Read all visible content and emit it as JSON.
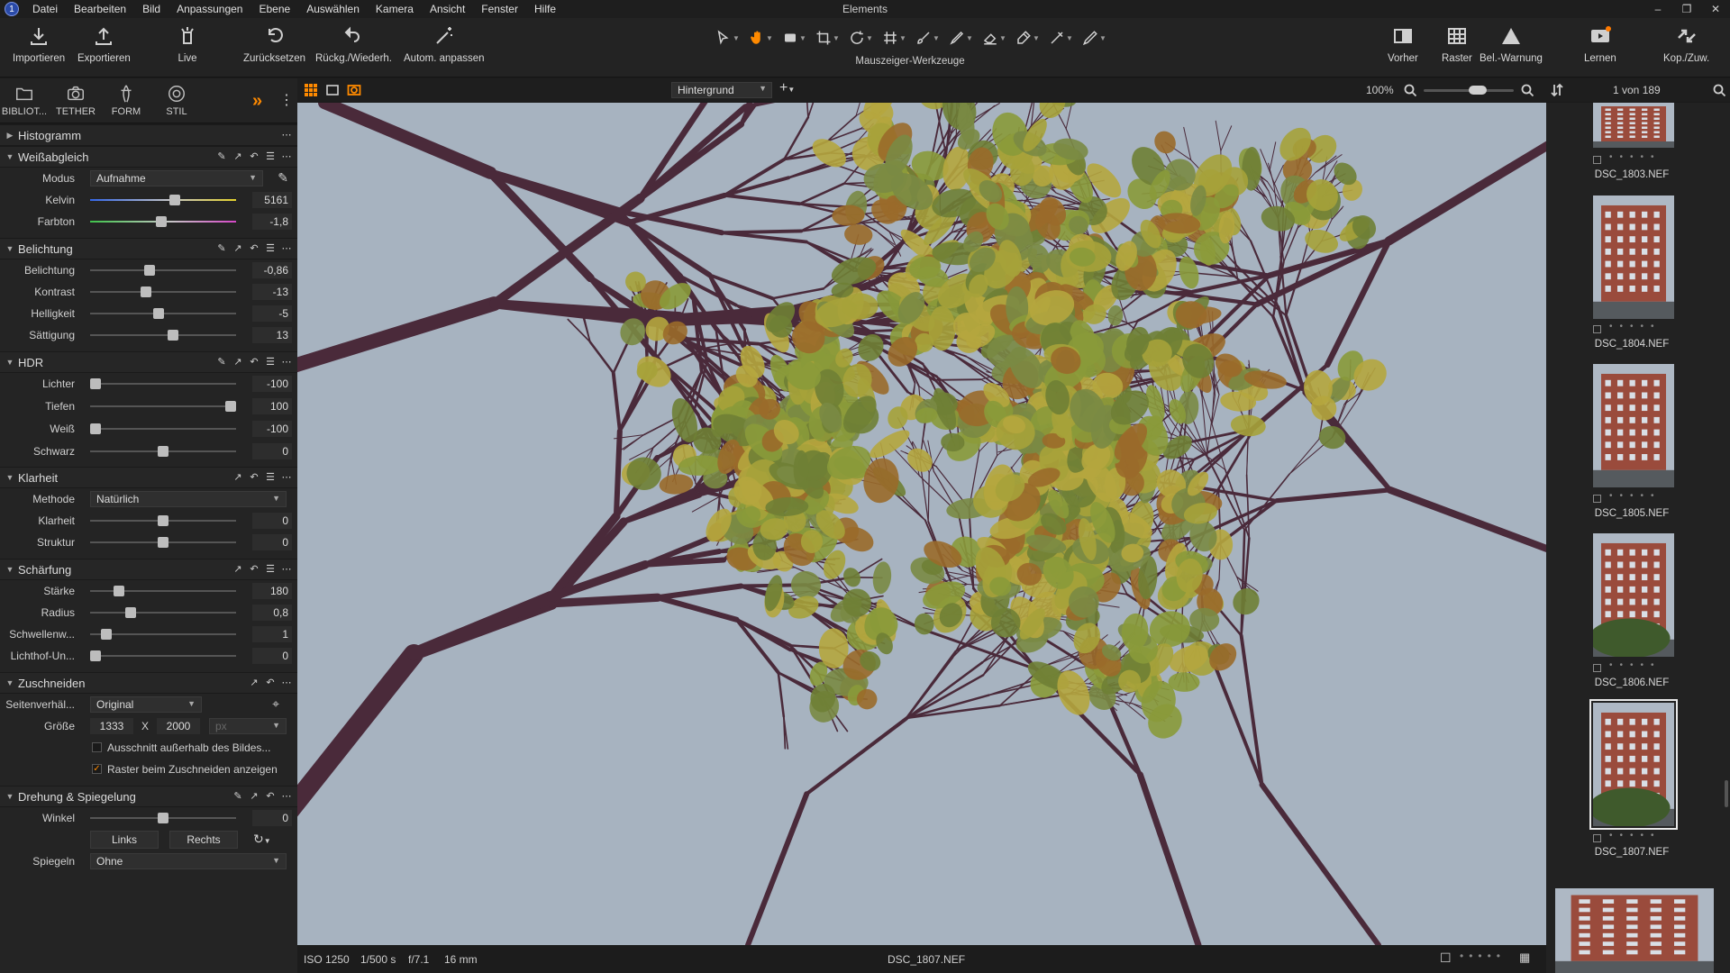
{
  "menu": {
    "items": [
      "Datei",
      "Bearbeiten",
      "Bild",
      "Anpassungen",
      "Ebene",
      "Auswählen",
      "Kamera",
      "Ansicht",
      "Fenster",
      "Hilfe"
    ],
    "window_title": "Elements"
  },
  "toolbar": {
    "importieren": "Importieren",
    "exportieren": "Exportieren",
    "live": "Live",
    "zuruecksetzen": "Zurücksetzen",
    "rueckg": "Rückg./Wiederh.",
    "autom": "Autom. anpassen",
    "cursor_tools_label": "Mauszeiger-Werkzeuge",
    "vorher": "Vorher",
    "raster": "Raster",
    "belwarnung": "Bel.-Warnung",
    "lernen": "Lernen",
    "kopzuw": "Kop./Zuw."
  },
  "tooltabs": {
    "bibliothek": "BIBLIOT...",
    "tether": "TETHER",
    "form": "FORM",
    "stil": "STIL"
  },
  "viewerbar": {
    "variant": "Hintergrund",
    "zoom": "100%",
    "count": "1 von 189"
  },
  "panels": {
    "histogramm": {
      "title": "Histogramm"
    },
    "weissabgleich": {
      "title": "Weißabgleich",
      "modus_label": "Modus",
      "modus_value": "Aufnahme",
      "kelvin_label": "Kelvin",
      "kelvin_value": "5161",
      "kelvin_pos": 0.58,
      "farbton_label": "Farbton",
      "farbton_value": "-1,8",
      "farbton_pos": 0.49
    },
    "belichtung": {
      "title": "Belichtung",
      "rows": [
        {
          "label": "Belichtung",
          "value": "-0,86",
          "pos": 0.41
        },
        {
          "label": "Kontrast",
          "value": "-13",
          "pos": 0.38
        },
        {
          "label": "Helligkeit",
          "value": "-5",
          "pos": 0.47
        },
        {
          "label": "Sättigung",
          "value": "13",
          "pos": 0.57
        }
      ]
    },
    "hdr": {
      "title": "HDR",
      "rows": [
        {
          "label": "Lichter",
          "value": "-100",
          "pos": 0.04
        },
        {
          "label": "Tiefen",
          "value": "100",
          "pos": 0.96
        },
        {
          "label": "Weiß",
          "value": "-100",
          "pos": 0.04
        },
        {
          "label": "Schwarz",
          "value": "0",
          "pos": 0.5
        }
      ]
    },
    "klarheit": {
      "title": "Klarheit",
      "methode_label": "Methode",
      "methode_value": "Natürlich",
      "rows": [
        {
          "label": "Klarheit",
          "value": "0",
          "pos": 0.5
        },
        {
          "label": "Struktur",
          "value": "0",
          "pos": 0.5
        }
      ]
    },
    "schaerfung": {
      "title": "Schärfung",
      "rows": [
        {
          "label": "Stärke",
          "value": "180",
          "pos": 0.2
        },
        {
          "label": "Radius",
          "value": "0,8",
          "pos": 0.28
        },
        {
          "label": "Schwellenw...",
          "value": "1",
          "pos": 0.11
        },
        {
          "label": "Lichthof-Un...",
          "value": "0",
          "pos": 0.04
        }
      ]
    },
    "zuschneiden": {
      "title": "Zuschneiden",
      "seiten_label": "Seitenverhäl...",
      "seiten_value": "Original",
      "groesse_label": "Größe",
      "w": "1333",
      "x": "X",
      "h": "2000",
      "unit": "px",
      "check1": "Ausschnitt außerhalb des Bildes...",
      "check2": "Raster beim Zuschneiden anzeigen"
    },
    "drehung": {
      "title": "Drehung & Spiegelung",
      "winkel_label": "Winkel",
      "winkel_value": "0",
      "winkel_pos": 0.5,
      "links": "Links",
      "rechts": "Rechts",
      "spiegeln_label": "Spiegeln",
      "spiegeln_value": "Ohne"
    }
  },
  "status": {
    "iso": "ISO 1250",
    "shutter": "1/500 s",
    "aperture": "f/7.1",
    "focal": "16 mm",
    "filename": "DSC_1807.NEF"
  },
  "browser": {
    "thumbs": [
      {
        "name": "DSC_1803.NEF"
      },
      {
        "name": "DSC_1804.NEF"
      },
      {
        "name": "DSC_1805.NEF"
      },
      {
        "name": "DSC_1806.NEF"
      },
      {
        "name": "DSC_1807.NEF"
      }
    ]
  }
}
